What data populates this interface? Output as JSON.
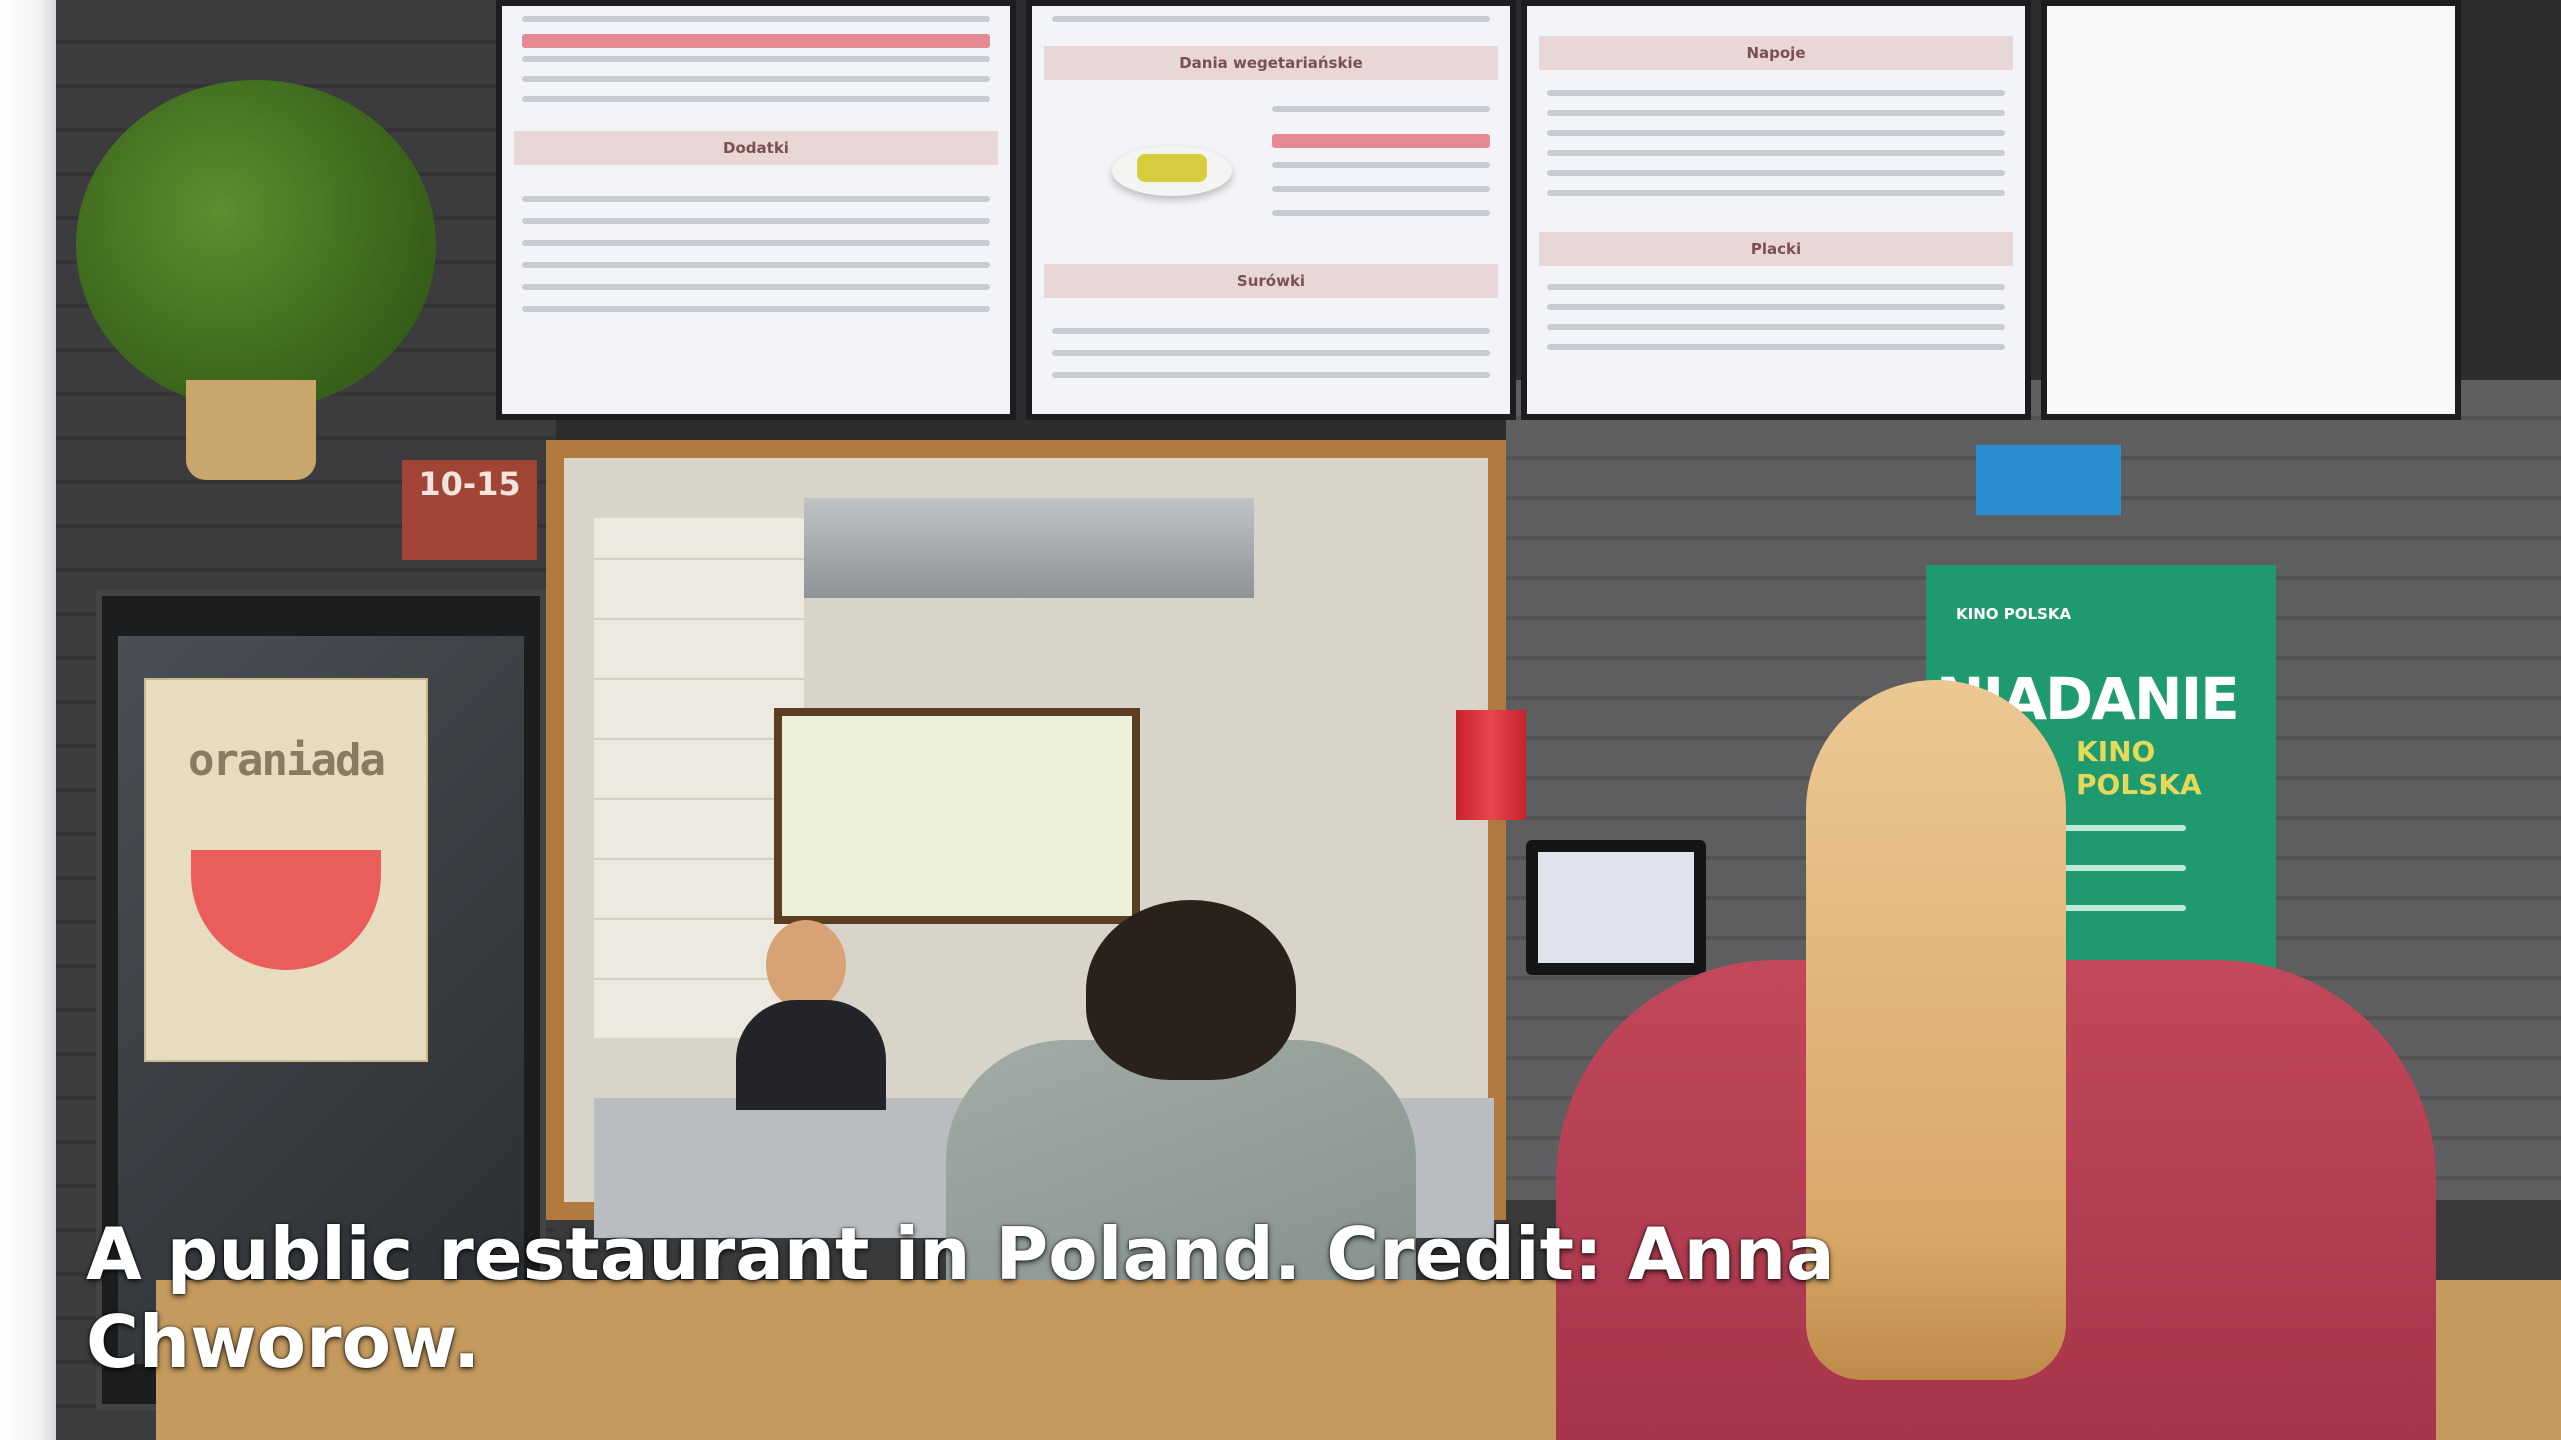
{
  "photo": {
    "caption": "A public restaurant in Poland. Credit: Anna Chworow.",
    "signs": {
      "opening_hours": "10-15",
      "poster_title": "oraniada",
      "green_poster_brand": "KINO POLSKA",
      "green_poster_heading": "NIADANIE",
      "green_poster_subheading": "KINO POLSKA"
    },
    "menu_board_sections": [
      "Dodatki",
      "Dania wegetariańskie",
      "Surówki",
      "Napoje",
      "Placki"
    ]
  }
}
